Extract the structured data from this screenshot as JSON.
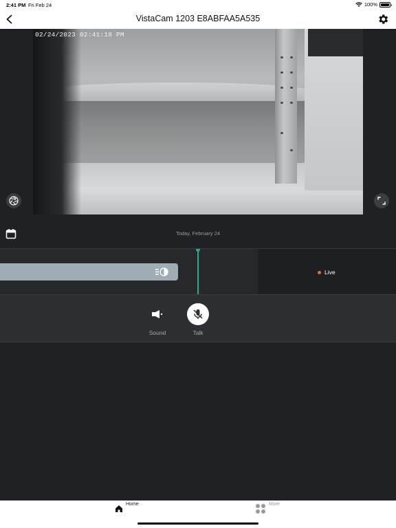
{
  "status_bar": {
    "time": "2:41 PM",
    "date": "Fri Feb 24",
    "battery": "100%",
    "icons": [
      "wifi-icon",
      "battery-icon"
    ]
  },
  "nav": {
    "title": "VistaCam 1203 E8ABFAA5A535",
    "back_icon": "chevron-left-icon",
    "settings_icon": "gear-icon"
  },
  "video": {
    "timestamp": "02/24/2023 02:41:18 PM",
    "left_button_icon": "aperture-icon",
    "right_button_icon": "fullscreen-icon"
  },
  "date_row": {
    "calendar_icon": "calendar-icon",
    "label": "Today, February 24"
  },
  "timeline": {
    "live_label": "Live",
    "track_icon": "recording-mode-icon",
    "colors": {
      "cursor": "#1fae8a",
      "live_dot": "#f0682b",
      "track": "#9eacb6"
    }
  },
  "controls": {
    "sound_label": "Sound",
    "talk_label": "Talk",
    "sound_icon": "speaker-icon",
    "talk_icon": "mic-off-icon"
  },
  "tabbar": {
    "home_label": "Home",
    "more_label": "More",
    "home_icon": "home-icon",
    "more_icon": "grid-dots-icon"
  }
}
